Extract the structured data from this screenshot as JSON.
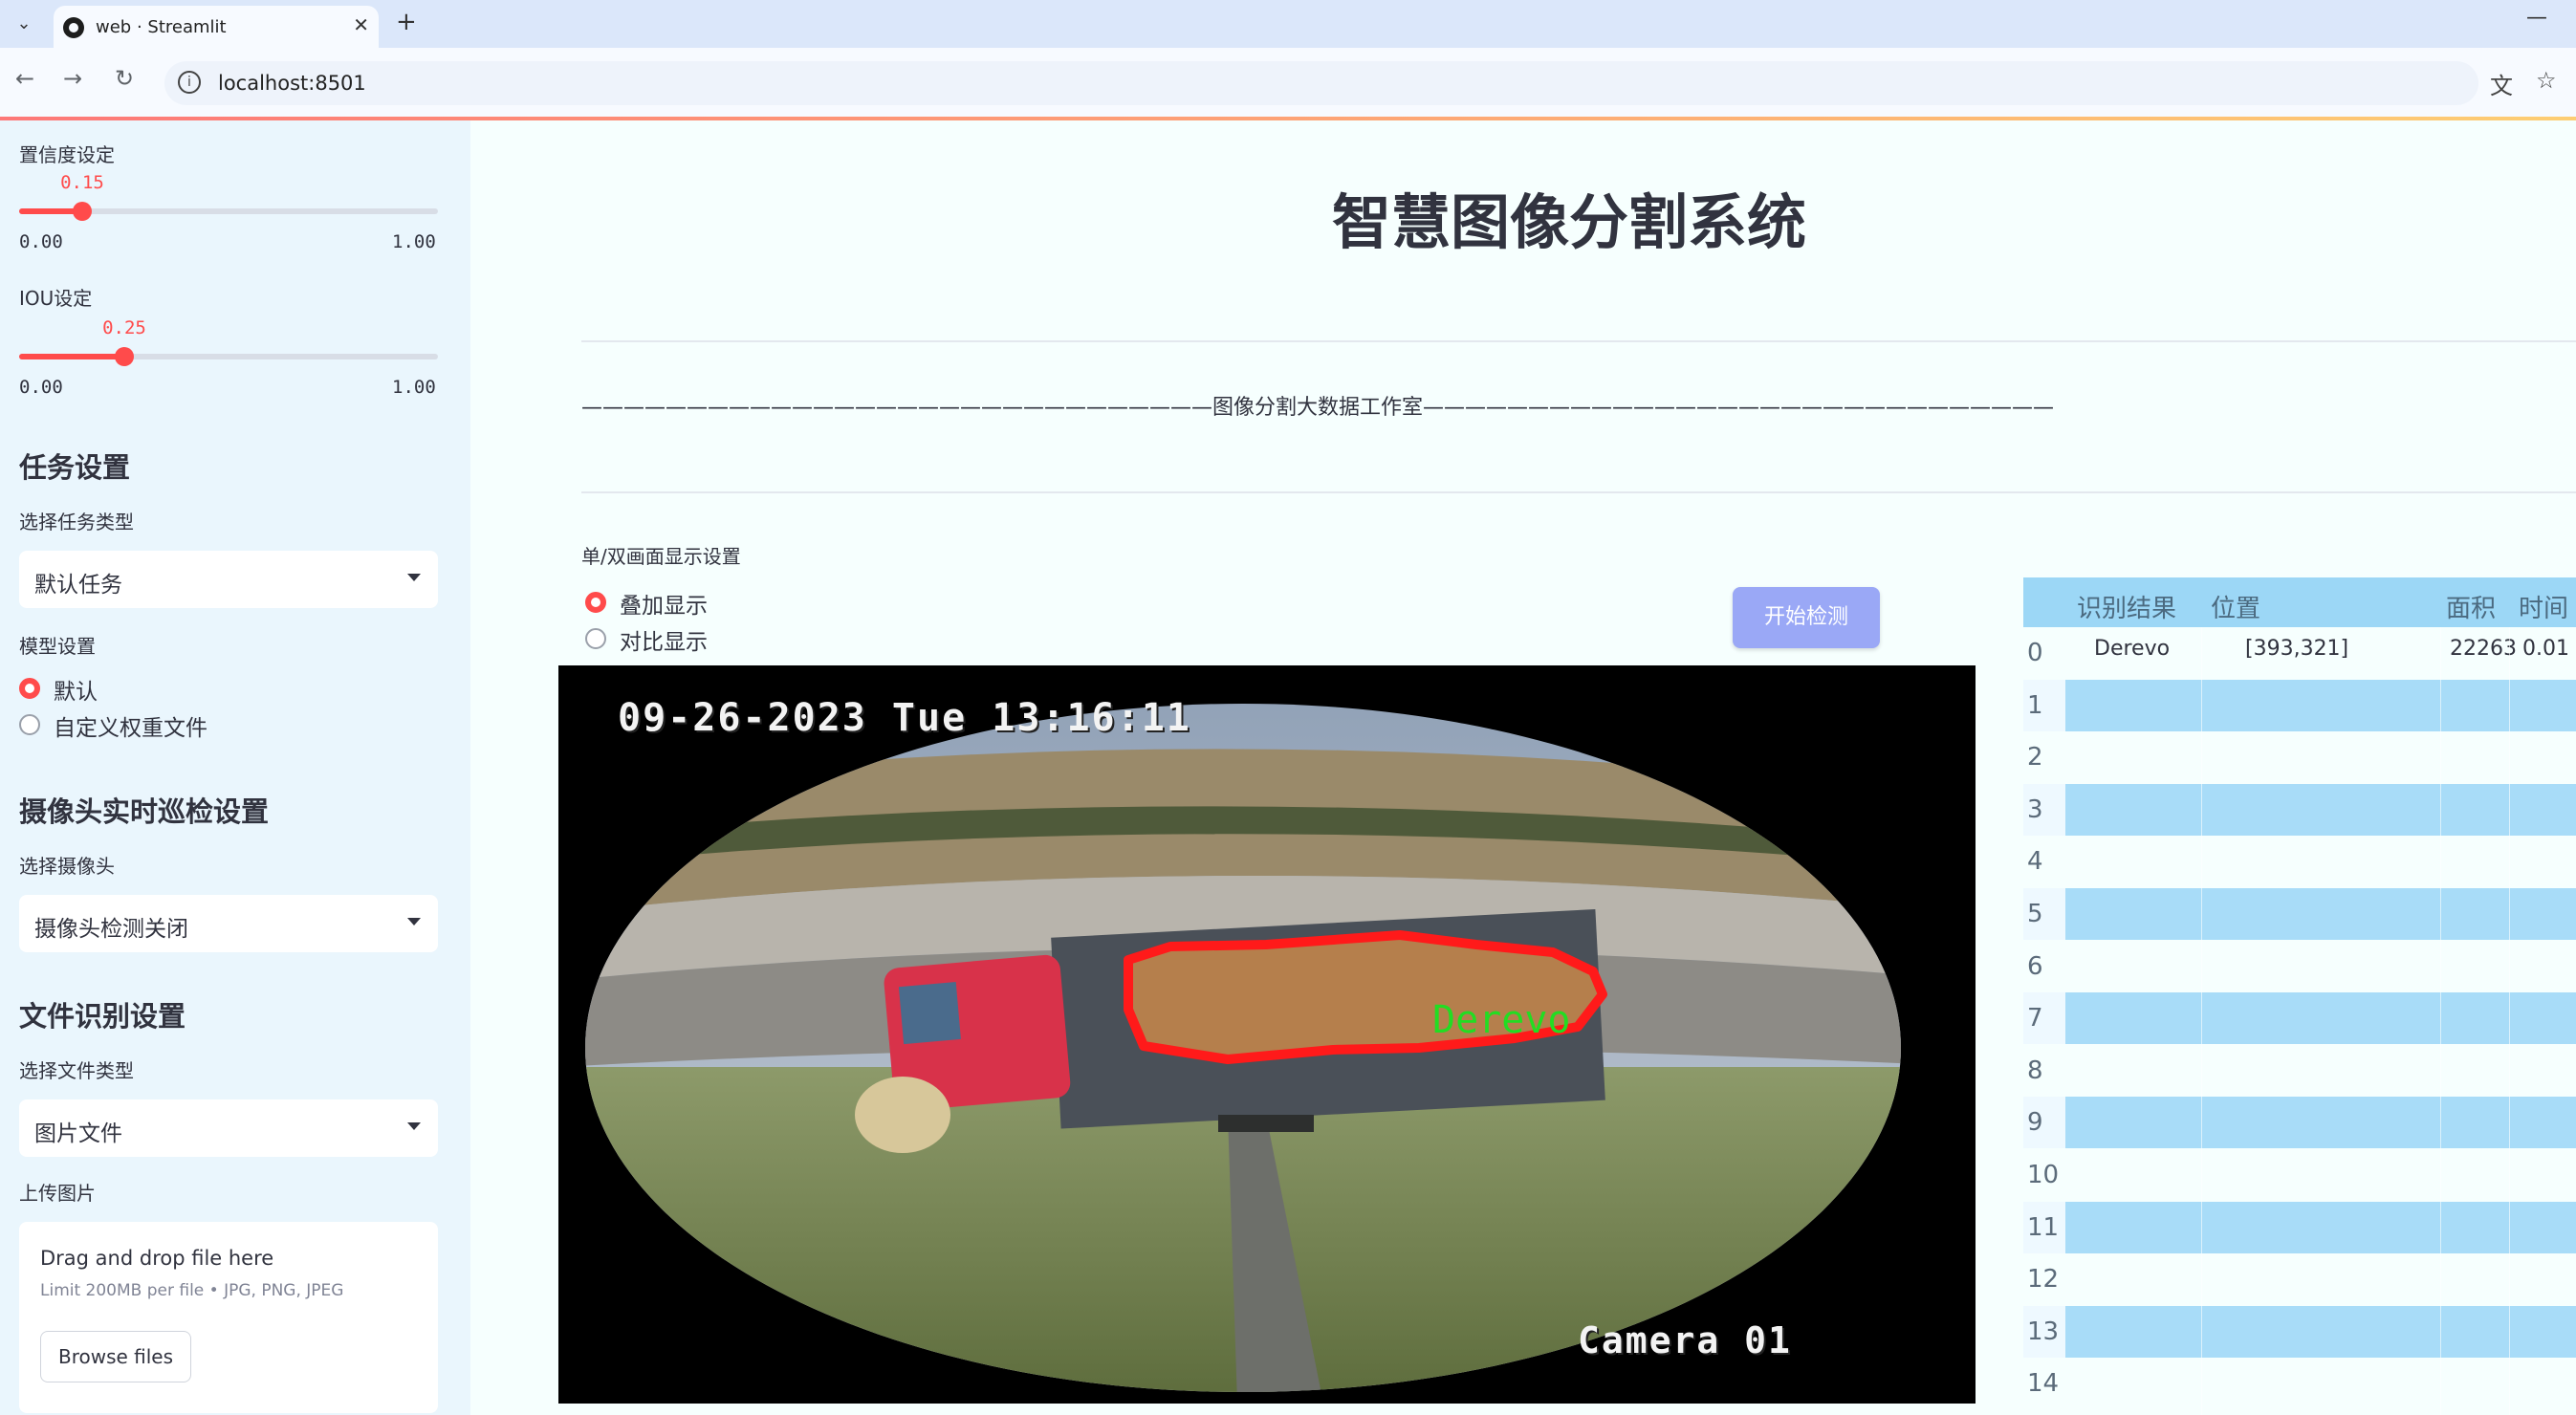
{
  "browser": {
    "tab_title": "web · Streamlit",
    "url": "localhost:8501"
  },
  "sidebar": {
    "confidence": {
      "label": "置信度设定",
      "value": "0.15",
      "min": "0.00",
      "max": "1.00",
      "fraction": 0.15
    },
    "iou": {
      "label": "IOU设定",
      "value": "0.25",
      "min": "0.00",
      "max": "1.00",
      "fraction": 0.25
    },
    "task_heading": "任务设置",
    "task_type_label": "选择任务类型",
    "task_type_value": "默认任务",
    "model_label": "模型设置",
    "model_options": [
      "默认",
      "自定义权重文件"
    ],
    "model_selected": 0,
    "camera_heading": "摄像头实时巡检设置",
    "camera_select_label": "选择摄像头",
    "camera_select_value": "摄像头检测关闭",
    "file_heading": "文件识别设置",
    "file_type_label": "选择文件类型",
    "file_type_value": "图片文件",
    "upload_label": "上传图片",
    "uploader": {
      "title": "Drag and drop file here",
      "subtitle": "Limit 200MB per file • JPG, PNG, JPEG",
      "button": "Browse files"
    }
  },
  "main": {
    "title": "智慧图像分割系统",
    "divider_text": "——————————————————————————————图像分割大数据工作室——————————————————————————————",
    "display_mode_label": "单/双画面显示设置",
    "display_options": [
      "叠加显示",
      "对比显示"
    ],
    "display_selected": 0,
    "detect_button": "开始检测"
  },
  "camera_view": {
    "timestamp": "09-26-2023 Tue 13:16:11",
    "camera_name": "Camera 01",
    "detection_label": "Derevo",
    "mask_color": "#ff1a1a"
  },
  "results_table": {
    "columns": [
      "识别结果",
      "位置",
      "面积",
      "时间"
    ],
    "rows": [
      {
        "index": "0",
        "result": "Derevo",
        "position": "[393,321]",
        "area": "22263",
        "time": "0.01"
      },
      {
        "index": "1"
      },
      {
        "index": "2"
      },
      {
        "index": "3"
      },
      {
        "index": "4"
      },
      {
        "index": "5"
      },
      {
        "index": "6"
      },
      {
        "index": "7"
      },
      {
        "index": "8"
      },
      {
        "index": "9"
      },
      {
        "index": "10"
      },
      {
        "index": "11"
      },
      {
        "index": "12"
      },
      {
        "index": "13"
      },
      {
        "index": "14"
      }
    ]
  }
}
